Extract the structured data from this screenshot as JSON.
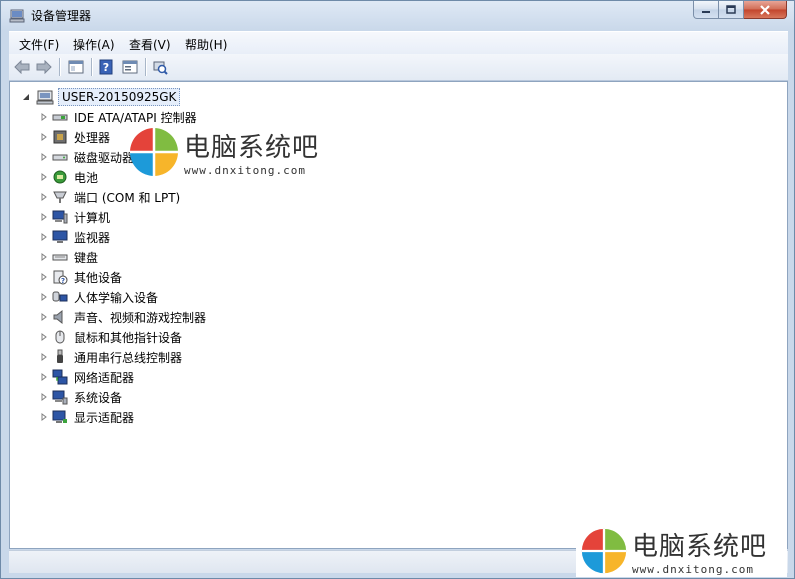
{
  "window": {
    "title": "设备管理器"
  },
  "menu": [
    {
      "label": "文件(F)"
    },
    {
      "label": "操作(A)"
    },
    {
      "label": "查看(V)"
    },
    {
      "label": "帮助(H)"
    }
  ],
  "toolbar": {
    "buttons": [
      "back-icon",
      "forward-icon",
      "show-hide-console-tree-icon",
      "help-icon",
      "properties-icon",
      "scan-hardware-icon"
    ]
  },
  "tree": {
    "root": "USER-20150925GK",
    "children": [
      {
        "label": "IDE ATA/ATAPI 控制器",
        "icon": "ide-controller-icon"
      },
      {
        "label": "处理器",
        "icon": "processor-icon"
      },
      {
        "label": "磁盘驱动器",
        "icon": "disk-drive-icon"
      },
      {
        "label": "电池",
        "icon": "battery-icon"
      },
      {
        "label": "端口 (COM 和 LPT)",
        "icon": "port-icon"
      },
      {
        "label": "计算机",
        "icon": "computer-icon"
      },
      {
        "label": "监视器",
        "icon": "monitor-icon"
      },
      {
        "label": "键盘",
        "icon": "keyboard-icon"
      },
      {
        "label": "其他设备",
        "icon": "other-devices-icon"
      },
      {
        "label": "人体学输入设备",
        "icon": "hid-icon"
      },
      {
        "label": "声音、视频和游戏控制器",
        "icon": "sound-icon"
      },
      {
        "label": "鼠标和其他指针设备",
        "icon": "mouse-icon"
      },
      {
        "label": "通用串行总线控制器",
        "icon": "usb-icon"
      },
      {
        "label": "网络适配器",
        "icon": "network-adapter-icon"
      },
      {
        "label": "系统设备",
        "icon": "system-devices-icon"
      },
      {
        "label": "显示适配器",
        "icon": "display-adapter-icon"
      }
    ]
  },
  "watermark": {
    "name": "电脑系统吧",
    "url": "www.dnxitong.com"
  }
}
